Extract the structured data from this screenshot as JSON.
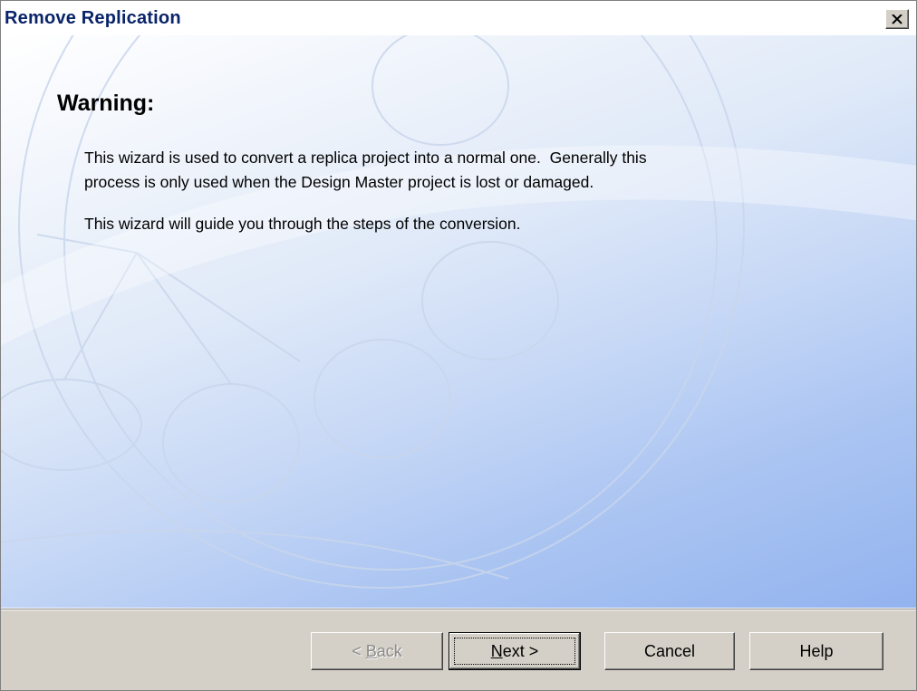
{
  "window": {
    "title": "Remove Replication"
  },
  "content": {
    "heading": "Warning:",
    "paragraph1_line1": "This wizard is used to convert a replica project into a normal one.  Generally this",
    "paragraph1_line2": "process is only used when the Design Master project is lost or damaged.",
    "paragraph2": "This wizard will guide you through the steps of the conversion."
  },
  "buttons": {
    "back_prefix": "< ",
    "back_accel": "B",
    "back_rest": "ack",
    "next_accel": "N",
    "next_rest": "ext >",
    "cancel": "Cancel",
    "help": "Help"
  },
  "icons": {
    "close": "close-icon"
  },
  "colors": {
    "title_text": "#0a246a",
    "dialog_face": "#d4d0c8",
    "panel_gradient_end": "#93b3ef"
  }
}
